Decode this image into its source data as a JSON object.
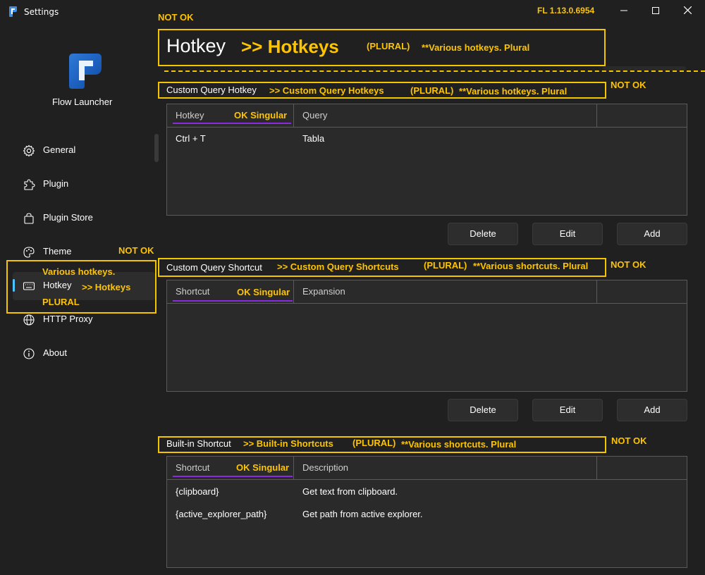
{
  "window": {
    "title": "Settings",
    "version": "FL 1.13.0.6954",
    "minimize": "—",
    "maximize": "☐",
    "close": "✕"
  },
  "sidebar": {
    "app_name": "Flow Launcher",
    "items": [
      {
        "label": "General",
        "icon": "gear-icon"
      },
      {
        "label": "Plugin",
        "icon": "puzzle-icon"
      },
      {
        "label": "Plugin Store",
        "icon": "shopping-bag-icon"
      },
      {
        "label": "Theme",
        "icon": "palette-icon"
      },
      {
        "label": "Hotkey",
        "icon": "keyboard-icon"
      },
      {
        "label": "HTTP Proxy",
        "icon": "globe-icon"
      },
      {
        "label": "About",
        "icon": "info-icon"
      }
    ]
  },
  "page": {
    "title": "Hotkey"
  },
  "custom_query_hotkey": {
    "title": "Custom Query Hotkey",
    "columns": [
      "Hotkey",
      "Query"
    ],
    "rows": [
      [
        "Ctrl + T",
        "Tabla"
      ]
    ],
    "buttons": {
      "delete": "Delete",
      "edit": "Edit",
      "add": "Add"
    }
  },
  "custom_query_shortcut": {
    "title": "Custom Query Shortcut",
    "columns": [
      "Shortcut",
      "Expansion"
    ],
    "rows": [],
    "buttons": {
      "delete": "Delete",
      "edit": "Edit",
      "add": "Add"
    }
  },
  "builtin_shortcut": {
    "title": "Built-in Shortcut",
    "columns": [
      "Shortcut",
      "Description"
    ],
    "rows": [
      [
        "{clipboard}",
        "Get text from clipboard."
      ],
      [
        "{active_explorer_path}",
        "Get path from active explorer."
      ]
    ]
  },
  "annotations": {
    "not_ok": "NOT OK",
    "page_title_suggest": ">> Hotkeys",
    "plural": "(PLURAL)",
    "various_hotkeys": "**Various hotkeys. Plural",
    "various_shortcuts": "**Various shortcuts. Plural",
    "cqh_suggest": ">> Custom Query Hotkeys",
    "cqs_suggest": ">> Custom Query Shortcuts",
    "bis_suggest": ">> Built-in Shortcuts",
    "ok_singular": "OK Singular",
    "sidebar_various": "Various hotkeys.",
    "sidebar_suggest": ">> Hotkeys",
    "sidebar_plural": "PLURAL"
  },
  "colors": {
    "background": "#202020",
    "annotation": "#ffc400",
    "accent": "#4cc2ff",
    "underline": "#8a2be2"
  }
}
